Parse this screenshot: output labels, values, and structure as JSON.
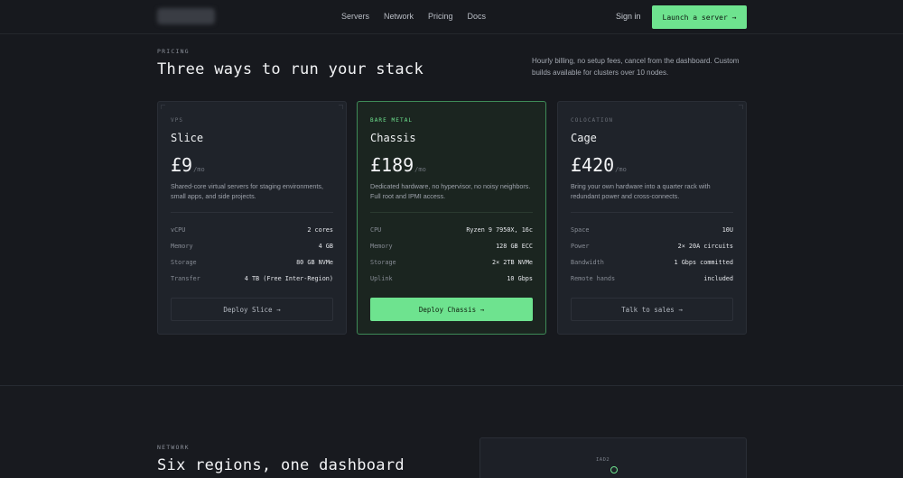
{
  "nav": {
    "links": [
      "Servers",
      "Network",
      "Pricing",
      "Docs"
    ],
    "signin": "Sign in",
    "launch": "Launch a server →"
  },
  "pricing": {
    "eyebrow": "PRICING",
    "title": "Three ways to run your stack",
    "note": "Hourly billing, no setup fees, cancel from the dashboard. Custom builds available for clusters over 10 nodes.",
    "plans": [
      {
        "tag": "VPS",
        "name": "Slice",
        "price": "£9",
        "per": "/mo",
        "desc": "Shared-core virtual servers for staging environments, small apps, and side projects.",
        "specs": [
          {
            "k": "vCPU",
            "v": "2 cores"
          },
          {
            "k": "Memory",
            "v": "4 GB"
          },
          {
            "k": "Storage",
            "v": "80 GB NVMe"
          },
          {
            "k": "Transfer",
            "v": "4 TB (Free Inter-Region)"
          }
        ],
        "cta": "Deploy Slice →"
      },
      {
        "tag": "BARE METAL",
        "name": "Chassis",
        "price": "£189",
        "per": "/mo",
        "desc": "Dedicated hardware, no hypervisor, no noisy neighbors. Full root and IPMI access.",
        "specs": [
          {
            "k": "CPU",
            "v": "Ryzen 9 7950X, 16c"
          },
          {
            "k": "Memory",
            "v": "128 GB ECC"
          },
          {
            "k": "Storage",
            "v": "2× 2TB NVMe"
          },
          {
            "k": "Uplink",
            "v": "10 Gbps"
          }
        ],
        "cta": "Deploy Chassis →"
      },
      {
        "tag": "COLOCATION",
        "name": "Cage",
        "price": "£420",
        "per": "/mo",
        "desc": "Bring your own hardware into a quarter rack with redundant power and cross-connects.",
        "specs": [
          {
            "k": "Space",
            "v": "10U"
          },
          {
            "k": "Power",
            "v": "2× 20A circuits"
          },
          {
            "k": "Bandwidth",
            "v": "1 Gbps committed"
          },
          {
            "k": "Remote hands",
            "v": "included"
          }
        ],
        "cta": "Talk to sales →"
      }
    ]
  },
  "network": {
    "eyebrow": "NETWORK",
    "title": "Six regions, one dashboard",
    "map_label": "IAD2"
  }
}
